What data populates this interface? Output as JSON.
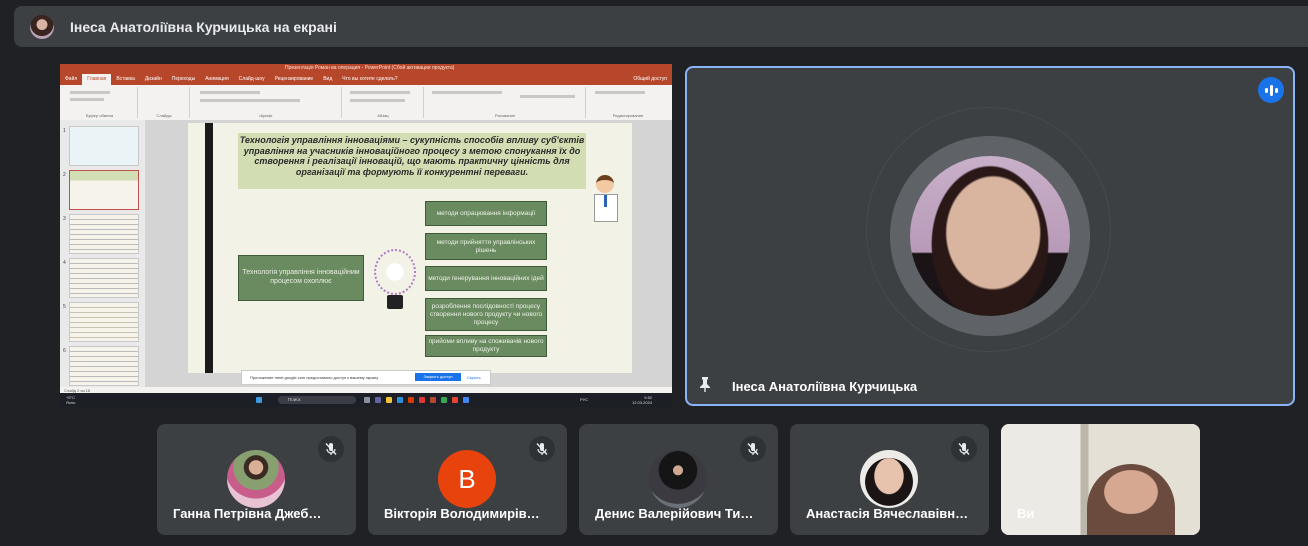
{
  "header": {
    "presenter_label": "Інеса Анатоліївна Курчицька на екрані"
  },
  "shared_screen": {
    "ppt_title": "Презентація Роман ва операция - PowerPoint (Сбой активации продукта)",
    "tabs": [
      "Файл",
      "Главная",
      "Вставка",
      "Дизайн",
      "Переходы",
      "Анимация",
      "Слайд-шоу",
      "Рецензирование",
      "Вид",
      "Что вы хотите сделать?",
      "Общий доступ"
    ],
    "ribbon_groups": [
      "Буфер обмена",
      "Слайды",
      "Шрифт",
      "Абзац",
      "Рисование",
      "Редактирование"
    ],
    "slide_numbers": [
      "1",
      "2",
      "3",
      "4",
      "5",
      "6"
    ],
    "slide": {
      "heading": "Технологія управління інноваціями – сукупність способів впливу суб'єктів управління на учасників інноваційного процесу з метою спонукання їх до створення і реалізації інновацій, що мають практичну цінність для організації та формують її конкурентні переваги.",
      "left_box": "Технологія управління інноваційним процесом охоплює",
      "right_boxes": [
        "методи опрацювання інформації",
        "методи прийняття управлінських рішень",
        "методи генерування інноваційних ідей",
        "розроблення послідовності процесу створення нового продукту чи нового процесу",
        "прийоми впливу на споживачів нового продукту"
      ]
    },
    "notification": {
      "text": "Приложение meet.google.com предоставило доступ к вашему экрану",
      "share_button": "Закрыть доступ",
      "hide_button": "Скрыть"
    },
    "status_bar": "Слайд 2 из 16",
    "taskbar": {
      "weather": "+5°C",
      "weather_sub": "Ясно",
      "search_placeholder": "Поиск",
      "time": "9:52",
      "date": "12.03.2024",
      "lang": "РУС"
    }
  },
  "speaker": {
    "name": "Інеса Анатоліївна Курчицька",
    "icons": [
      "audio-levels-icon",
      "pin-icon"
    ]
  },
  "participants": [
    {
      "name": "Ганна Петрівна Джеб…",
      "initial": "",
      "muted": true
    },
    {
      "name": "Вікторія Володимирів…",
      "initial": "В",
      "muted": true
    },
    {
      "name": "Денис Валерійович Ти…",
      "initial": "",
      "muted": true
    },
    {
      "name": "Анастасія Вячеславівн…",
      "initial": "",
      "muted": true
    },
    {
      "name": "Ви",
      "initial": "",
      "muted": false
    }
  ],
  "colors": {
    "background": "#202124",
    "tile": "#3c4043",
    "accent": "#8ab4f8",
    "audio": "#1a73e8",
    "letter_avatar": "#e8430c",
    "ppt_brand": "#b7472a"
  }
}
